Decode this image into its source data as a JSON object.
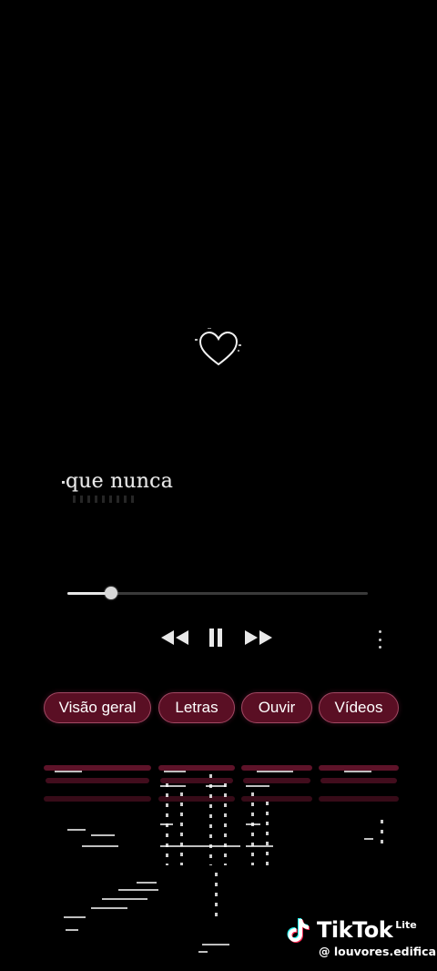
{
  "lyric": {
    "text": "que nunca"
  },
  "player": {
    "progress_fraction": 0.145,
    "controls": {
      "rewind_icon": "rewind-icon",
      "pause_icon": "pause-icon",
      "forward_icon": "fast-forward-icon",
      "more_icon": "more-vertical-icon"
    }
  },
  "chips": [
    {
      "label": "Visão geral"
    },
    {
      "label": "Letras"
    },
    {
      "label": "Ouvir"
    },
    {
      "label": "Vídeos"
    }
  ],
  "watermark": {
    "brand": "TikTok",
    "brand_suffix": "Lite",
    "handle": "@ louvores.edifica"
  },
  "colors": {
    "chip_bg": "#5a0f24",
    "chip_border": "#a14863",
    "background": "#000000"
  }
}
